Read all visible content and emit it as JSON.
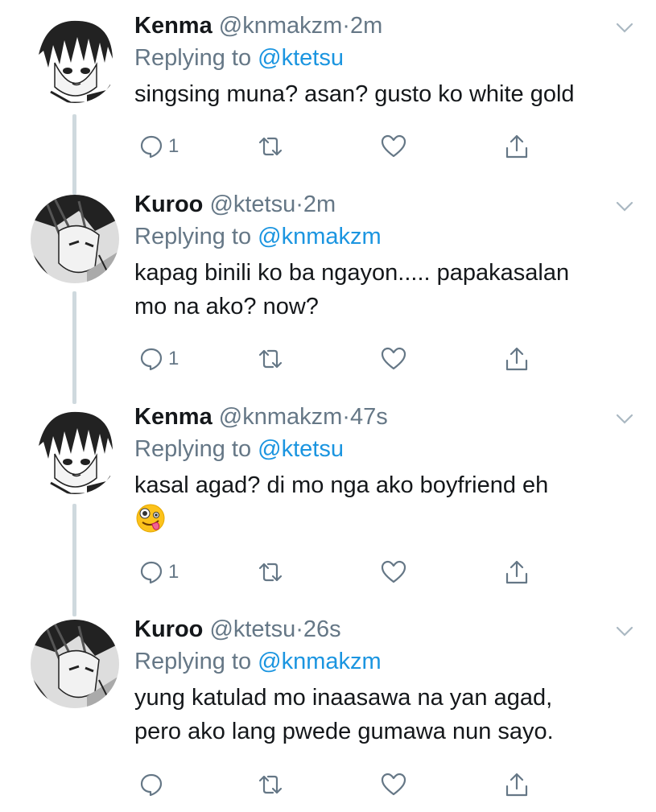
{
  "tweets": [
    {
      "name": "Kenma",
      "handle": "@knmakzm",
      "time": "2m",
      "replying_prefix": "Replying to",
      "replying_to": "@ktetsu",
      "text_lines": [
        "singsing muna? asan? gusto ko white gold"
      ],
      "reply_count": "1",
      "avatar": "kenma-avatar"
    },
    {
      "name": "Kuroo",
      "handle": "@ktetsu",
      "time": "2m",
      "replying_prefix": "Replying to",
      "replying_to": "@knmakzm",
      "text_lines": [
        "kapag binili ko ba ngayon..... papakasalan",
        "mo na ako? now?"
      ],
      "reply_count": "1",
      "avatar": "kuroo-avatar"
    },
    {
      "name": "Kenma",
      "handle": "@knmakzm",
      "time": "47s",
      "replying_prefix": "Replying to",
      "replying_to": "@ktetsu",
      "text_lines": [
        "kasal agad? di mo nga ako boyfriend eh"
      ],
      "emoji": "zany-face-emoji",
      "reply_count": "1",
      "avatar": "kenma-avatar"
    },
    {
      "name": "Kuroo",
      "handle": "@ktetsu",
      "time": "26s",
      "replying_prefix": "Replying to",
      "replying_to": "@knmakzm",
      "text_lines": [
        "yung katulad mo inaasawa na yan agad,",
        "pero ako lang pwede gumawa nun sayo."
      ],
      "reply_count": "",
      "avatar": "kuroo-avatar"
    }
  ],
  "dot": "·",
  "colors": {
    "link": "#1b95e0",
    "secondary": "#657786",
    "text": "#14171a",
    "thread_line": "#cfd9de"
  },
  "icons": [
    "reply-icon",
    "retweet-icon",
    "like-icon",
    "share-icon",
    "chevron-down-icon"
  ]
}
